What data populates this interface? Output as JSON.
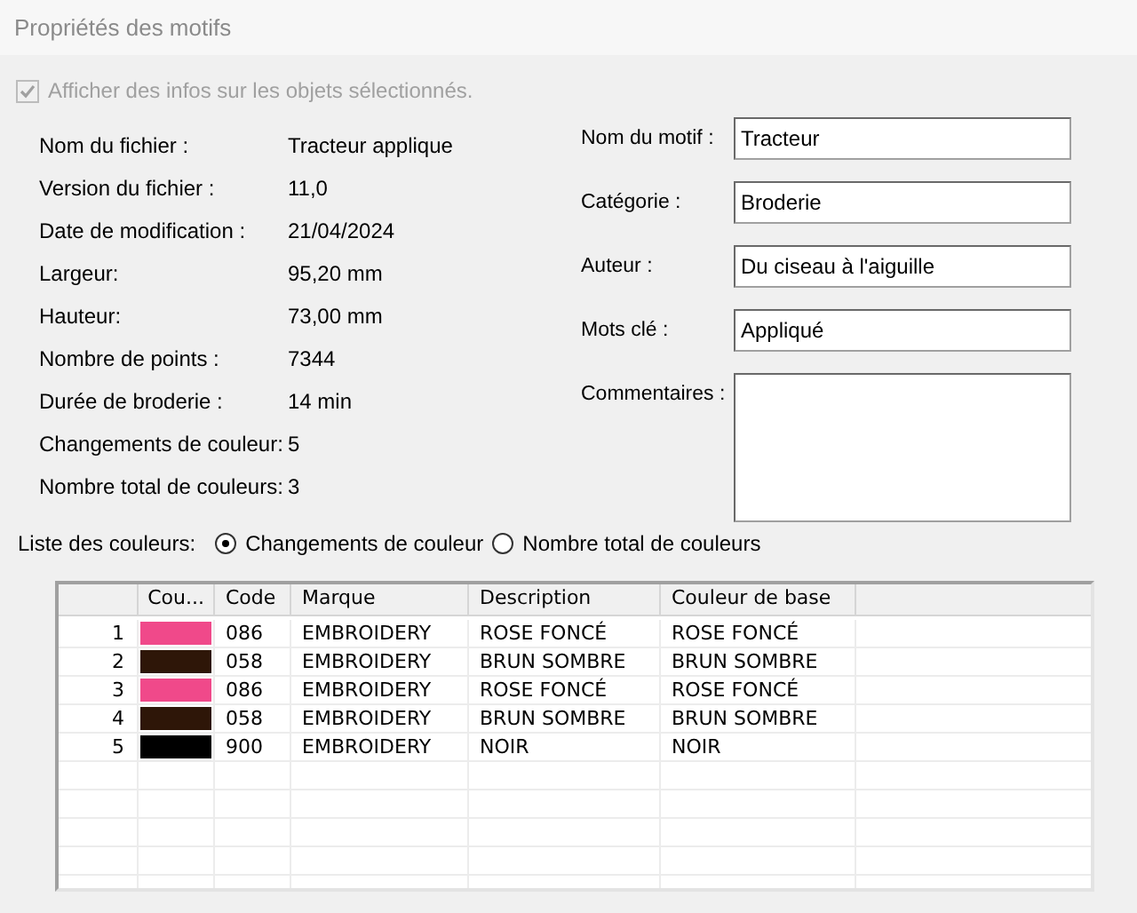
{
  "window": {
    "title": "Propriétés des motifs"
  },
  "show_info": {
    "label": "Afficher des infos sur les objets sélectionnés.",
    "checked": true,
    "disabled": true
  },
  "info": [
    {
      "label": "Nom du fichier :",
      "value": "Tracteur applique"
    },
    {
      "label": "Version du fichier :",
      "value": "11,0"
    },
    {
      "label": "Date de modification :",
      "value": "21/04/2024"
    },
    {
      "label": "Largeur:",
      "value": "95,20 mm"
    },
    {
      "label": "Hauteur:",
      "value": "73,00 mm"
    },
    {
      "label": "Nombre de points :",
      "value": "7344"
    },
    {
      "label": "Durée de broderie :",
      "value": "14 min"
    },
    {
      "label": "Changements de couleur:",
      "value": "5"
    },
    {
      "label": "Nombre total de couleurs:",
      "value": "3"
    }
  ],
  "fields": [
    {
      "label": "Nom du motif :",
      "value": "Tracteur",
      "kind": "line"
    },
    {
      "label": "Catégorie :",
      "value": "Broderie",
      "kind": "line"
    },
    {
      "label": "Auteur :",
      "value": "Du ciseau à l'aiguille",
      "kind": "line"
    },
    {
      "label": "Mots clé :",
      "value": "Appliqué",
      "kind": "line"
    },
    {
      "label": "Commentaires :",
      "kind": "area"
    }
  ],
  "color_list": {
    "label": "Liste des couleurs:",
    "options": [
      {
        "label": "Changements de couleur",
        "selected": true
      },
      {
        "label": "Nombre total de couleurs",
        "selected": false
      }
    ]
  },
  "table": {
    "columns": [
      "Cou...",
      "Code",
      "Marque",
      "Description",
      "Couleur de base"
    ],
    "rows": [
      {
        "number": "1",
        "color": "#f0498a",
        "code": "086",
        "brand": "EMBROIDERY",
        "description": "ROSE FONCÉ",
        "base": "ROSE FONCÉ"
      },
      {
        "number": "2",
        "color": "#2e1608",
        "code": "058",
        "brand": "EMBROIDERY",
        "description": "BRUN SOMBRE",
        "base": "BRUN SOMBRE"
      },
      {
        "number": "3",
        "color": "#f0498a",
        "code": "086",
        "brand": "EMBROIDERY",
        "description": "ROSE FONCÉ",
        "base": "ROSE FONCÉ"
      },
      {
        "number": "4",
        "color": "#2e1608",
        "code": "058",
        "brand": "EMBROIDERY",
        "description": "BRUN SOMBRE",
        "base": "BRUN SOMBRE"
      },
      {
        "number": "5",
        "color": "#000000",
        "code": "900",
        "brand": "EMBROIDERY",
        "description": "NOIR",
        "base": "NOIR"
      }
    ]
  }
}
